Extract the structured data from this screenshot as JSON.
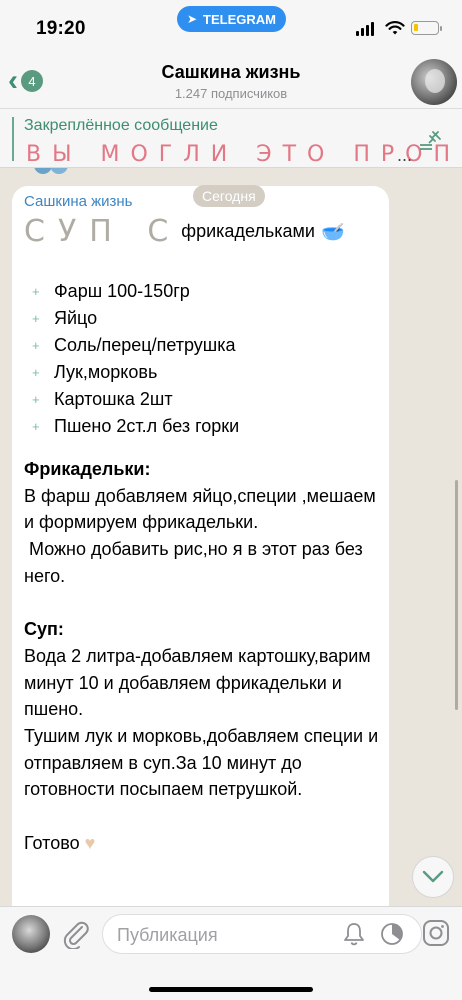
{
  "status_bar": {
    "time": "19:20",
    "app_pill": "TELEGRAM",
    "battery_level": 0.2
  },
  "header": {
    "back_badge": "4",
    "channel_title": "Сашкина жизнь",
    "subscribers": "1.247 подписчиков"
  },
  "pinned": {
    "label": "Закреплённое сообщение",
    "text": "ВЫ МОГЛИ ЭТО ПРОП",
    "ellipsis": "..."
  },
  "chat": {
    "date": "Сегодня",
    "message": {
      "author": "Сашкина жизнь",
      "title_big": "СУП С",
      "title_rest": "фрикадельками",
      "title_emoji": "🥣",
      "ingredients": [
        " Фарш 100-150гр",
        "Яйцо",
        "Соль/перец/петрушка",
        "Лук,морковь",
        "Картошка 2шт",
        "Пшено 2ст.л без горки"
      ],
      "section1_heading": "Фрикадельки:",
      "section1_text": "В фарш добавляем яйцо,специи ,мешаем и формируем фрикадельки.\n Можно добавить рис,но я в этот раз без него.",
      "section2_heading": "Суп:",
      "section2_text": "Вода 2 литра-добавляем картошку,варим минут 10 и добавляем фрикадельки и пшено.\nТушим лук и морковь,добавляем специи и отправляем в суп.За 10 минут до готовности посыпаем петрушкой.",
      "closing": "Готово",
      "closing_emoji": "♥"
    }
  },
  "composer": {
    "placeholder": "Публикация"
  },
  "icons": {
    "back": "chevron-left-icon",
    "pin": "pinned-list-icon",
    "scroll": "chevron-down-icon",
    "attach": "paperclip-icon",
    "bell": "bell-icon",
    "timer": "timer-icon",
    "instagram": "instagram-icon"
  },
  "colors": {
    "accent": "#3e8e6f",
    "author": "#3f86c2",
    "pinned_text": "#e27786",
    "telegram_pill": "#2f8ff0"
  }
}
